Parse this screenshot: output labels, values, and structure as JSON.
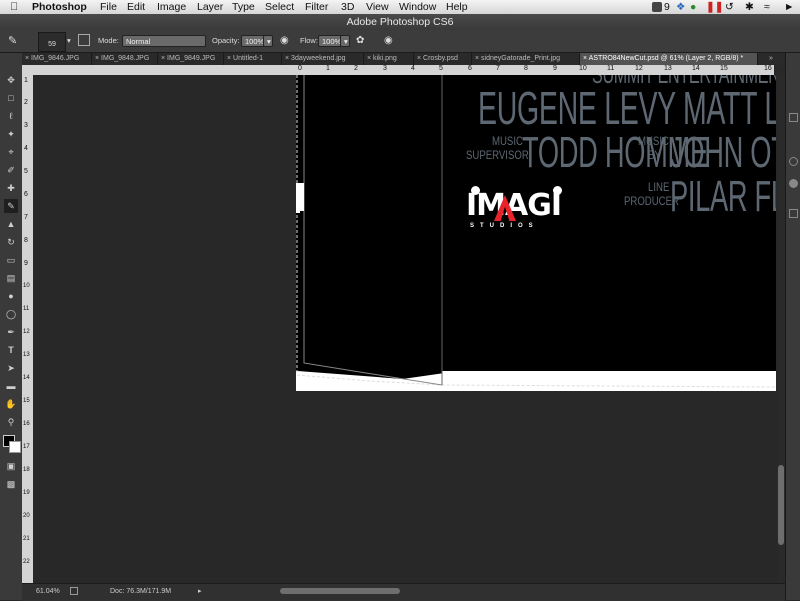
{
  "menubar": {
    "apple_icon": "apple-logo",
    "app_name": "Photoshop",
    "items": [
      "File",
      "Edit",
      "Image",
      "Layer",
      "Type",
      "Select",
      "Filter",
      "3D",
      "View",
      "Window",
      "Help"
    ],
    "status_number": "9",
    "status_icons": [
      "adobe-icon",
      "dropbox-icon",
      "evernote-icon",
      "pause-icon",
      "time-machine-icon",
      "bluetooth-icon",
      "wifi-icon",
      "volume-icon"
    ]
  },
  "window": {
    "title": "Adobe Photoshop CS6"
  },
  "options_bar": {
    "brush_size": "59",
    "mode_label": "Mode:",
    "mode_value": "Normal",
    "opacity_label": "Opacity:",
    "opacity_value": "100%",
    "flow_label": "Flow:",
    "flow_value": "100%"
  },
  "tabs": [
    {
      "label": "IMG_9846.JPG",
      "active": false
    },
    {
      "label": "IMG_9848.JPG",
      "active": false
    },
    {
      "label": "IMG_9849.JPG",
      "active": false
    },
    {
      "label": "Untitled-1",
      "active": false
    },
    {
      "label": "3dayweekend.jpg",
      "active": false
    },
    {
      "label": "kiki.png",
      "active": false
    },
    {
      "label": "Crosby.psd",
      "active": false
    },
    {
      "label": "sidneyGatorade_Print.jpg",
      "active": false
    },
    {
      "label": "ASTRO84NewCut.psd @ 61% (Layer 2, RGB/8) *",
      "active": true
    }
  ],
  "ruler": {
    "h_ticks": [
      "0",
      "1",
      "2",
      "3",
      "4",
      "5",
      "6",
      "7",
      "8",
      "9",
      "10",
      "11",
      "12",
      "13",
      "14",
      "15",
      "16"
    ],
    "v_ticks": [
      "1",
      "2",
      "3",
      "4",
      "5",
      "6",
      "7",
      "8",
      "9",
      "10",
      "11",
      "12",
      "13",
      "14",
      "15",
      "16",
      "17",
      "18",
      "19",
      "20",
      "21",
      "22"
    ]
  },
  "poster": {
    "partial_top": "SUMMIT ENTERTAINMENT",
    "cast": "EUGENE LEVY  MATT LUCAS  BILL NIGHY",
    "music_supervisor_role_1": "MUSIC",
    "music_supervisor_role_2": "SUPERVISOR",
    "music_supervisor_name": "TODD HOMME",
    "music_by_role_1": "MUSIC",
    "music_by_role_2": "BY",
    "music_by_name": "JOHN OTTMAN",
    "line_producer_role_1": "LINE",
    "line_producer_role_2": "PRODUCER",
    "line_producer_name": "PILAR FLYNN",
    "logo_text": "IMAGI",
    "logo_sub": "STUDIOS"
  },
  "status_bar": {
    "zoom": "61.04%",
    "doc_size": "Doc: 76.3M/171.9M"
  },
  "colors": {
    "credit_text": "#5e6873",
    "logo_red": "#e8232a",
    "workspace": "#282828"
  }
}
